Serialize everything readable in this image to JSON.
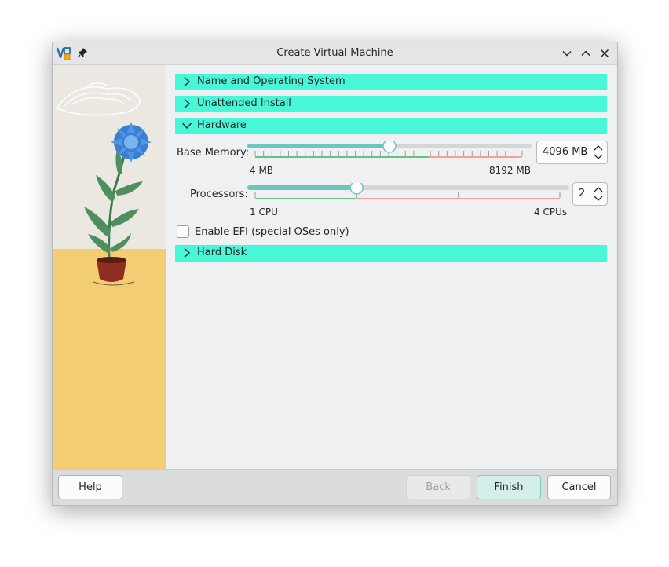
{
  "window": {
    "title": "Create Virtual Machine"
  },
  "sections": {
    "name_os": "Name and Operating System",
    "unattended": "Unattended Install",
    "hardware": "Hardware",
    "hard_disk": "Hard Disk"
  },
  "hardware": {
    "base_memory": {
      "label": "Base Memory:",
      "min_label": "4 MB",
      "max_label": "8192 MB",
      "value": "4096 MB",
      "fraction": 0.5
    },
    "processors": {
      "label": "Processors:",
      "min_label": "1 CPU",
      "max_label": "4 CPUs",
      "value": "2",
      "fraction": 0.333
    },
    "efi": {
      "label": "Enable EFI (special OSes only)",
      "checked": false
    }
  },
  "footer": {
    "help": "Help",
    "back": "Back",
    "finish": "Finish",
    "cancel": "Cancel"
  },
  "icons": {
    "app": "virtualbox-icon",
    "pin": "pin-icon",
    "minimize": "chevron-down-icon",
    "maximize": "chevron-up-icon",
    "close": "close-icon"
  },
  "colors": {
    "section_header": "#47f7d8",
    "slider_fill": "#6ac7b9",
    "slider_track": "#d3d5d7",
    "tick_ok": "#67c184",
    "tick_warn": "#f0a195",
    "default_button": "#d4eee9"
  }
}
